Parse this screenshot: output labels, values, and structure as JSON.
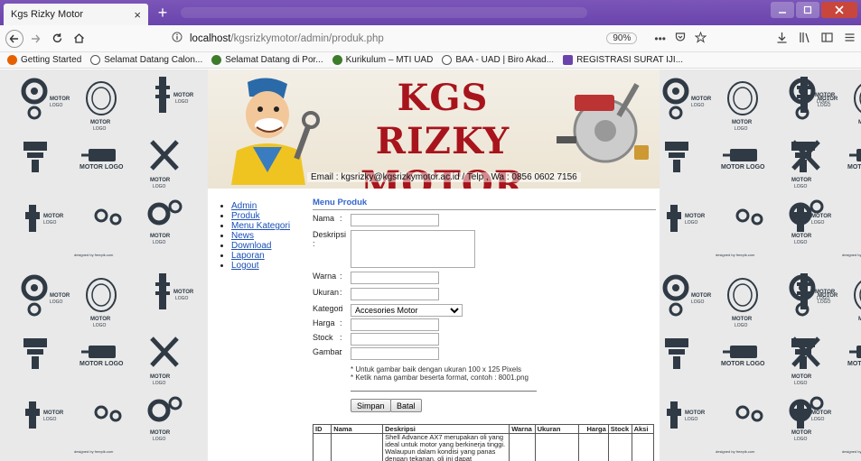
{
  "browser": {
    "tab_title": "Kgs Rizky Motor",
    "tab_close": "×",
    "new_tab": "+",
    "url_host": "localhost",
    "url_path": "/kgsrizkymotor/admin/produk.php",
    "zoom": "90%",
    "more": "•••"
  },
  "bookmarks": [
    "Getting Started",
    "Selamat Datang Calon...",
    "Selamat Datang di Por...",
    "Kurikulum – MTI UAD",
    "BAA - UAD | Biro Akad...",
    "REGISTRASI SURAT IJI..."
  ],
  "banner": {
    "title_line1": "KGS RIZKY",
    "title_line2": "MOTOR",
    "contact": "Email : kgsrizky@kgsrizkymotor.ac.id / Telp , Wa : 0856 0602 7156"
  },
  "pattern": {
    "caption_motor": "MOTOR",
    "caption_logo": "LOGO",
    "caption_motor_logo": "MOTOR LOGO",
    "credit": "designed by freepik.com"
  },
  "sidebar": {
    "items": [
      "Admin",
      "Produk",
      "Menu Kategori",
      "News",
      "Download",
      "Laporan",
      "Logout"
    ]
  },
  "form": {
    "title": "Menu Produk",
    "colon": ":",
    "nama_label": "Nama",
    "deskripsi_label": "Deskripsi",
    "warna_label": "Warna",
    "ukuran_label": "Ukuran",
    "kategori_label": "Kategori",
    "kategori_value": "Accesories Motor",
    "harga_label": "Harga",
    "stock_label": "Stock",
    "gambar_label": "Gambar",
    "note1": "* Untuk gambar baik dengan ukuran 100 x 125 Pixels",
    "note2": "* Ketik nama gambar beserta format, contoh : 8001.png",
    "save_label": "Simpan",
    "cancel_label": "Batal"
  },
  "table": {
    "headers": [
      "ID",
      "Nama",
      "Deskripsi",
      "Warna",
      "Ukuran",
      "Harga",
      "Stock",
      "Aksi"
    ],
    "row1_desc": "Shell Advance AX7 merupakan oli yang ideal untuk motor yang berkinerja tinggi. Walaupun dalam kondisi yang panas dengan tekanan, oli ini dapat"
  }
}
